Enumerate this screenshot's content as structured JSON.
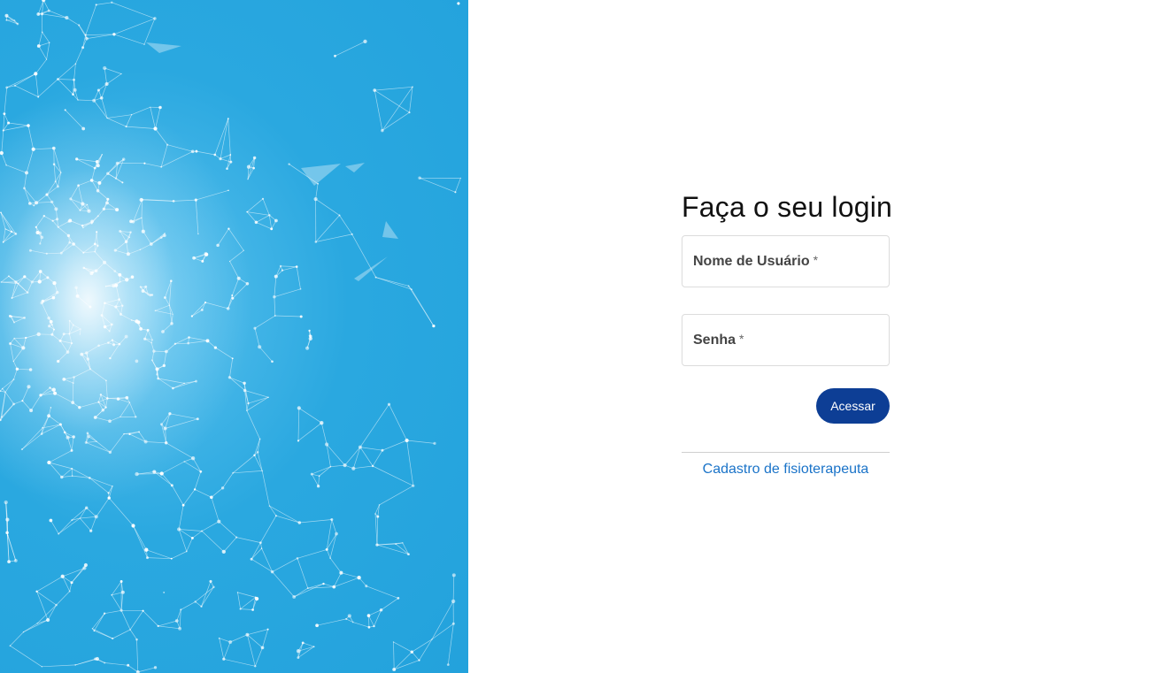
{
  "login": {
    "title": "Faça o seu login",
    "username_label": "Nome de Usuário",
    "password_label": "Senha",
    "required_mark": "*",
    "submit_label": "Acessar",
    "register_link": "Cadastro de fisioterapeuta"
  },
  "colors": {
    "hero_background": "#23a2dc",
    "primary_button": "#0d3e95",
    "link": "#1a73c8"
  }
}
